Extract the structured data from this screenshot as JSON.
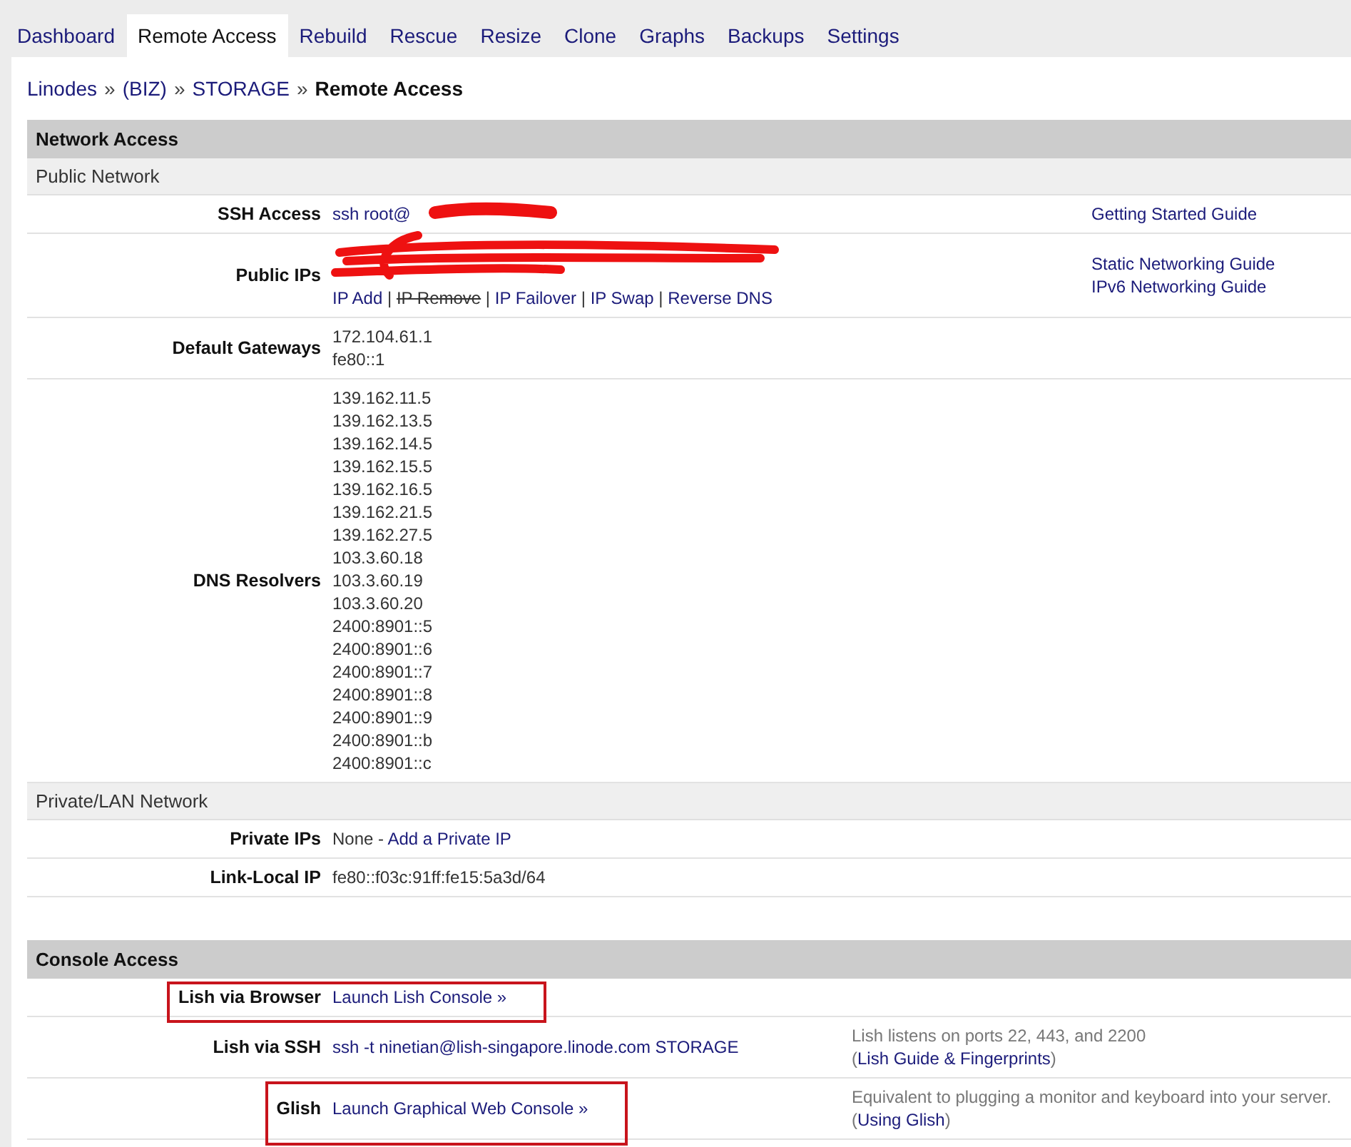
{
  "tabs": [
    {
      "label": "Dashboard",
      "selected": false
    },
    {
      "label": "Remote Access",
      "selected": true
    },
    {
      "label": "Rebuild",
      "selected": false
    },
    {
      "label": "Rescue",
      "selected": false
    },
    {
      "label": "Resize",
      "selected": false
    },
    {
      "label": "Clone",
      "selected": false
    },
    {
      "label": "Graphs",
      "selected": false
    },
    {
      "label": "Backups",
      "selected": false
    },
    {
      "label": "Settings",
      "selected": false
    }
  ],
  "breadcrumb": {
    "links": [
      "Linodes",
      "(BIZ)",
      "STORAGE"
    ],
    "separator": "»",
    "current": "Remote Access"
  },
  "sections": [
    {
      "title": "Network Access",
      "groups": [
        {
          "title": "Public Network",
          "rows": [
            {
              "label": "SSH Access",
              "highlighted": false,
              "redacted": true,
              "lines": [
                [
                  {
                    "kind": "link",
                    "text": "ssh root@"
                  }
                ]
              ],
              "notes": {
                "kind": "guides",
                "lines": [
                  [
                    {
                      "kind": "link",
                      "text": "Getting Started Guide"
                    }
                  ]
                ]
              }
            },
            {
              "label": "Public IPs",
              "highlighted": false,
              "redacted": true,
              "lines": [
                [
                  {
                    "kind": "link",
                    "text": "IP Add"
                  },
                  {
                    "kind": "text",
                    "text": " | "
                  },
                  {
                    "kind": "strike",
                    "text": "IP Remove"
                  },
                  {
                    "kind": "text",
                    "text": " | "
                  },
                  {
                    "kind": "link",
                    "text": "IP Failover"
                  },
                  {
                    "kind": "text",
                    "text": " | "
                  },
                  {
                    "kind": "link",
                    "text": "IP Swap"
                  },
                  {
                    "kind": "text",
                    "text": " | "
                  },
                  {
                    "kind": "link",
                    "text": "Reverse DNS"
                  }
                ]
              ],
              "notes": {
                "kind": "guides",
                "lines": [
                  [
                    {
                      "kind": "link",
                      "text": "Static Networking Guide"
                    }
                  ],
                  [
                    {
                      "kind": "link",
                      "text": "IPv6 Networking Guide"
                    }
                  ]
                ]
              }
            },
            {
              "label": "Default Gateways",
              "highlighted": false,
              "redacted": false,
              "lines": [
                [
                  {
                    "kind": "text",
                    "text": "172.104.61.1"
                  }
                ],
                [
                  {
                    "kind": "text",
                    "text": "fe80::1"
                  }
                ]
              ]
            },
            {
              "label": "DNS Resolvers",
              "highlighted": false,
              "redacted": false,
              "lines": [
                [
                  {
                    "kind": "text",
                    "text": "139.162.11.5"
                  }
                ],
                [
                  {
                    "kind": "text",
                    "text": "139.162.13.5"
                  }
                ],
                [
                  {
                    "kind": "text",
                    "text": "139.162.14.5"
                  }
                ],
                [
                  {
                    "kind": "text",
                    "text": "139.162.15.5"
                  }
                ],
                [
                  {
                    "kind": "text",
                    "text": "139.162.16.5"
                  }
                ],
                [
                  {
                    "kind": "text",
                    "text": "139.162.21.5"
                  }
                ],
                [
                  {
                    "kind": "text",
                    "text": "139.162.27.5"
                  }
                ],
                [
                  {
                    "kind": "text",
                    "text": "103.3.60.18"
                  }
                ],
                [
                  {
                    "kind": "text",
                    "text": "103.3.60.19"
                  }
                ],
                [
                  {
                    "kind": "text",
                    "text": "103.3.60.20"
                  }
                ],
                [
                  {
                    "kind": "text",
                    "text": "2400:8901::5"
                  }
                ],
                [
                  {
                    "kind": "text",
                    "text": "2400:8901::6"
                  }
                ],
                [
                  {
                    "kind": "text",
                    "text": "2400:8901::7"
                  }
                ],
                [
                  {
                    "kind": "text",
                    "text": "2400:8901::8"
                  }
                ],
                [
                  {
                    "kind": "text",
                    "text": "2400:8901::9"
                  }
                ],
                [
                  {
                    "kind": "text",
                    "text": "2400:8901::b"
                  }
                ],
                [
                  {
                    "kind": "text",
                    "text": "2400:8901::c"
                  }
                ]
              ]
            }
          ]
        },
        {
          "title": "Private/LAN Network",
          "rows": [
            {
              "label": "Private IPs",
              "highlighted": false,
              "redacted": false,
              "lines": [
                [
                  {
                    "kind": "text",
                    "text": "None - "
                  },
                  {
                    "kind": "link",
                    "text": "Add a Private IP"
                  }
                ]
              ]
            },
            {
              "label": "Link-Local IP",
              "highlighted": false,
              "redacted": false,
              "lines": [
                [
                  {
                    "kind": "text",
                    "text": "fe80::f03c:91ff:fe15:5a3d/64"
                  }
                ]
              ]
            }
          ]
        }
      ]
    },
    {
      "title": "Console Access",
      "groups": [
        {
          "rows": [
            {
              "label": "Lish via Browser",
              "highlighted": true,
              "redacted": false,
              "lines": [
                [
                  {
                    "kind": "link",
                    "text": "Launch Lish Console »"
                  }
                ]
              ]
            },
            {
              "label": "Lish via SSH",
              "highlighted": false,
              "redacted": false,
              "lines": [
                [
                  {
                    "kind": "link",
                    "text": "ssh -t ninetian@lish-singapore.linode.com STORAGE"
                  }
                ]
              ],
              "notes": {
                "kind": "info",
                "lines": [
                  [
                    {
                      "kind": "text",
                      "text": "Lish listens on ports 22, 443, and 2200"
                    }
                  ],
                  [
                    {
                      "kind": "text",
                      "text": "("
                    },
                    {
                      "kind": "link",
                      "text": "Lish Guide & Fingerprints"
                    },
                    {
                      "kind": "text",
                      "text": ")"
                    }
                  ]
                ]
              }
            },
            {
              "label": "Glish",
              "highlighted": true,
              "redacted": false,
              "lines": [
                [
                  {
                    "kind": "link",
                    "text": "Launch Graphical Web Console »"
                  }
                ]
              ],
              "notes": {
                "kind": "info",
                "lines": [
                  [
                    {
                      "kind": "text",
                      "text": "Equivalent to plugging a monitor and keyboard into your server."
                    }
                  ],
                  [
                    {
                      "kind": "text",
                      "text": "("
                    },
                    {
                      "kind": "link",
                      "text": "Using Glish"
                    },
                    {
                      "kind": "text",
                      "text": ")"
                    }
                  ]
                ]
              }
            }
          ]
        }
      ]
    }
  ]
}
